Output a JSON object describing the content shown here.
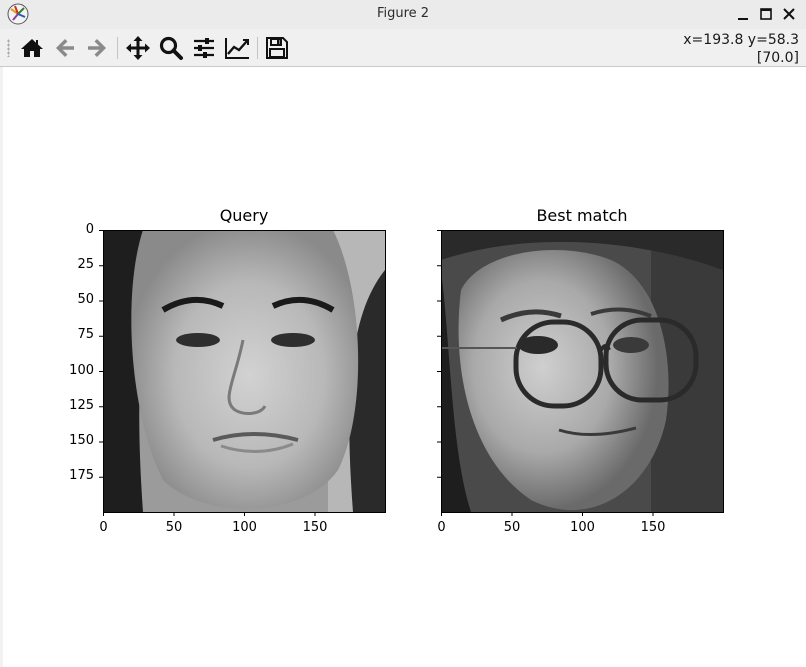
{
  "window": {
    "title": "Figure 2",
    "icons": [
      "matplotlib-logo-icon",
      "minimize-icon",
      "maximize-icon",
      "close-icon"
    ]
  },
  "toolbar": {
    "buttons": [
      "home-icon",
      "back-arrow-icon",
      "forward-arrow-icon",
      "pan-icon",
      "zoom-icon",
      "configure-subplots-icon",
      "edit-axis-icon",
      "save-icon"
    ],
    "coord_line1": "x=193.8 y=58.3",
    "coord_line2": "[70.0]"
  },
  "figure": {
    "left_axes": {
      "title": "Query",
      "y_ticks": [
        "0",
        "25",
        "50",
        "75",
        "100",
        "125",
        "150",
        "175"
      ],
      "x_ticks": [
        "0",
        "50",
        "100",
        "150"
      ]
    },
    "right_axes": {
      "title": "Best match",
      "x_ticks": [
        "0",
        "50",
        "100",
        "150"
      ]
    }
  }
}
